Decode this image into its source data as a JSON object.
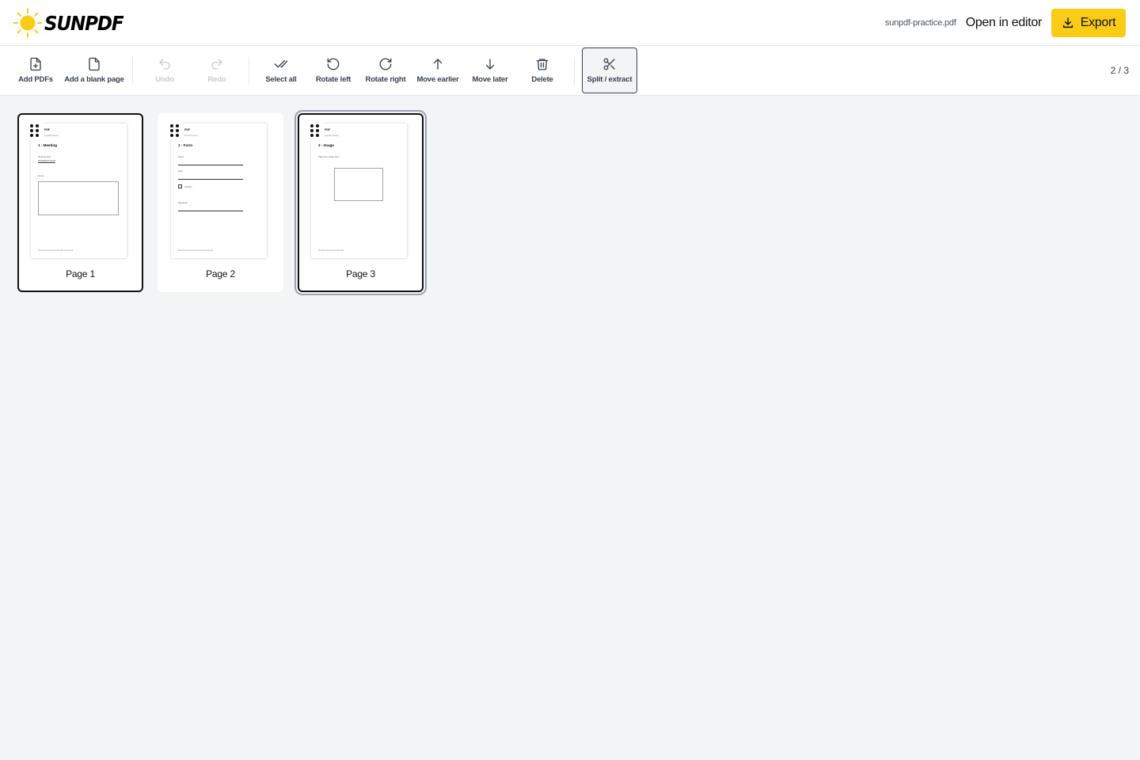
{
  "header": {
    "logo_text": "SUNPDF",
    "filename": "sunpdf-practice.pdf",
    "open_editor_label": "Open in editor",
    "export_label": "Export",
    "accent_color": "#facc15"
  },
  "toolbar": {
    "add_pdfs": "Add PDFs",
    "add_blank": "Add a blank page",
    "undo": "Undo",
    "redo": "Redo",
    "select_all": "Select all",
    "rotate_left": "Rotate left",
    "rotate_right": "Rotate right",
    "move_earlier": "Move earlier",
    "move_later": "Move later",
    "delete": "Delete",
    "split_extract": "Split / extract",
    "page_count": "2 / 3"
  },
  "pages": [
    {
      "label": "Page 1",
      "selected": true,
      "thumb": {
        "brand": "PDF",
        "subtitle": "sunpdf-practice",
        "title": "1 - Meeting",
        "field1_label": "Meeting date",
        "field1_value": "2024/06/15 10:00",
        "notes_label": "Notes",
        "footer": "Practice document text for tests and demos"
      }
    },
    {
      "label": "Page 2",
      "selected": false,
      "thumb": {
        "brand": "PDF",
        "subtitle": "fill out the form",
        "title": "2 - Form",
        "name_label": "Name",
        "date_label": "Date",
        "check_label": "Confirm",
        "signature_label": "Signature",
        "footer": "Practice document text for tests and demos"
      }
    },
    {
      "label": "Page 3",
      "selected": true,
      "thumb": {
        "brand": "PDF",
        "subtitle": "sunpdf-practice",
        "title": "3 - Image",
        "caption": "Place the image here",
        "footer": "Practice document text for tests"
      }
    }
  ]
}
